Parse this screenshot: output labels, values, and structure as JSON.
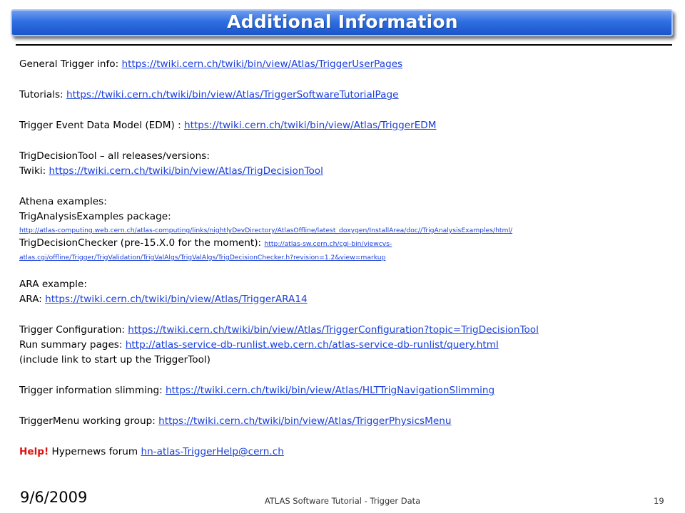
{
  "slide": {
    "title": "Additional Information"
  },
  "lines": {
    "general_label": "General Trigger info: ",
    "general_link": "https://twiki.cern.ch/twiki/bin/view/Atlas/TriggerUserPages",
    "tutorials_label": "Tutorials: ",
    "tutorials_link": "https://twiki.cern.ch/twiki/bin/view/Atlas/TriggerSoftwareTutorialPage",
    "edm_label": "Trigger Event Data Model (EDM) : ",
    "edm_link": "https://twiki.cern.ch/twiki/bin/view/Atlas/TriggerEDM",
    "tdt_heading": "TrigDecisionTool – all releases/versions:",
    "tdt_label": "Twiki: ",
    "tdt_link": "https://twiki.cern.ch/twiki/bin/view/Atlas/TrigDecisionTool",
    "athena_heading": "Athena examples:",
    "tae_label": "TrigAnalysisExamples package:",
    "tae_link": "http://atlas-computing.web.cern.ch/atlas-computing/links/nightlyDevDirectory/AtlasOffline/latest_doxygen/InstallArea/doc//TrigAnalysisExamples/html/",
    "tdc_label": "TrigDecisionChecker (pre-15.X.0 for the moment): ",
    "tdc_link_part1": "http://atlas-sw.cern.ch/cgi-bin/viewcvs-",
    "tdc_link_part2": "atlas.cgi/offline/Trigger/TrigValidation/TrigValAlgs/TrigValAlgs/TrigDecisionChecker.h?revision=1.2&view=markup",
    "ara_heading": "ARA example:",
    "ara_label": "ARA: ",
    "ara_link": "https://twiki.cern.ch/twiki/bin/view/Atlas/TriggerARA14",
    "config_label": "Trigger Configuration: ",
    "config_link": "https://twiki.cern.ch/twiki/bin/view/Atlas/TriggerConfiguration?topic=TrigDecisionTool",
    "runsum_label": "Run summary pages: ",
    "runsum_link": "http://atlas-service-db-runlist.web.cern.ch/atlas-service-db-runlist/query.html",
    "runsum_note": "(include link to start up the TriggerTool)",
    "slim_label": "Trigger information slimming: ",
    "slim_link": "https://twiki.cern.ch/twiki/bin/view/Atlas/HLTTrigNavigationSlimming",
    "menu_label": "TriggerMenu working group: ",
    "menu_link": "https://twiki.cern.ch/twiki/bin/view/Atlas/TriggerPhysicsMenu",
    "help_label": "Help!",
    "help_text": " Hypernews forum ",
    "help_link": "hn-atlas-TriggerHelp@cern.ch"
  },
  "footer": {
    "date": "9/6/2009",
    "center": "ATLAS Software Tutorial - Trigger Data",
    "page": "19"
  },
  "colors": {
    "title_bar": "#2f6fe2",
    "link": "#1a3fd8",
    "help": "#e01010"
  }
}
